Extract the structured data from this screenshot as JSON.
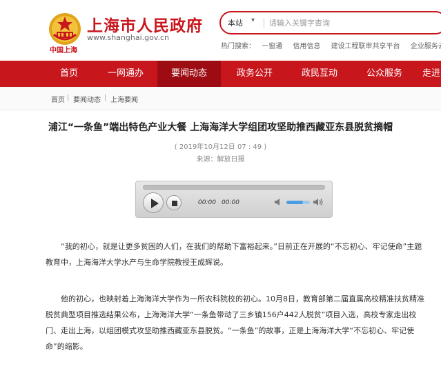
{
  "header": {
    "title": "上海市人民政府",
    "url": "www.shanghai.gov.cn",
    "logo_subtitle": "中国上海",
    "colors": {
      "brand_red": "#c8161d",
      "nav_active": "#9c0c12"
    }
  },
  "search": {
    "scope": "本站",
    "placeholder": "请输入关键字查询",
    "hot_label": "热门搜索：",
    "hot_items": [
      "一窗通",
      "信用信息",
      "建设工程联审共享平台",
      "企业服务云"
    ]
  },
  "nav": {
    "items": [
      "首页",
      "一网通办",
      "要闻动态",
      "政务公开",
      "政民互动",
      "公众服务",
      "走进"
    ],
    "active_index": 2
  },
  "breadcrumb": [
    "首页",
    "要闻动态",
    "上海要闻"
  ],
  "article": {
    "title": "浦江“一条鱼”端出特色产业大餐 上海海洋大学组团攻坚助推西藏亚东县脱贫摘帽",
    "date": "( 2019年10月12日 07 : 49 )",
    "source": "来源：解放日报",
    "paragraphs": [
      "“我的初心，就是让更多贫困的人们，在我们的帮助下富裕起来。”日前正在开展的“不忘初心、牢记使命”主题教育中，上海海洋大学水产与生命学院教授王成辉说。",
      "他的初心，也映射着上海海洋大学作为一所农科院校的初心。10月8日，教育部第二届直属高校精准扶贫精准脱贫典型项目推选结果公布，上海海洋大学“一条鱼带动了三乡镇156户442人脱贫”项目入选，高校专家走出校门、走出上海，以组团模式攻坚助推西藏亚东县脱贫。“一条鱼”的故事，正是上海海洋大学“不忘初心、牢记使命”的缩影。"
    ]
  },
  "player": {
    "current_time": "00:00",
    "duration": "00:00",
    "volume": 0.7,
    "icons": [
      "play-icon",
      "stop-icon",
      "volume-low-icon",
      "volume-high-icon"
    ]
  }
}
